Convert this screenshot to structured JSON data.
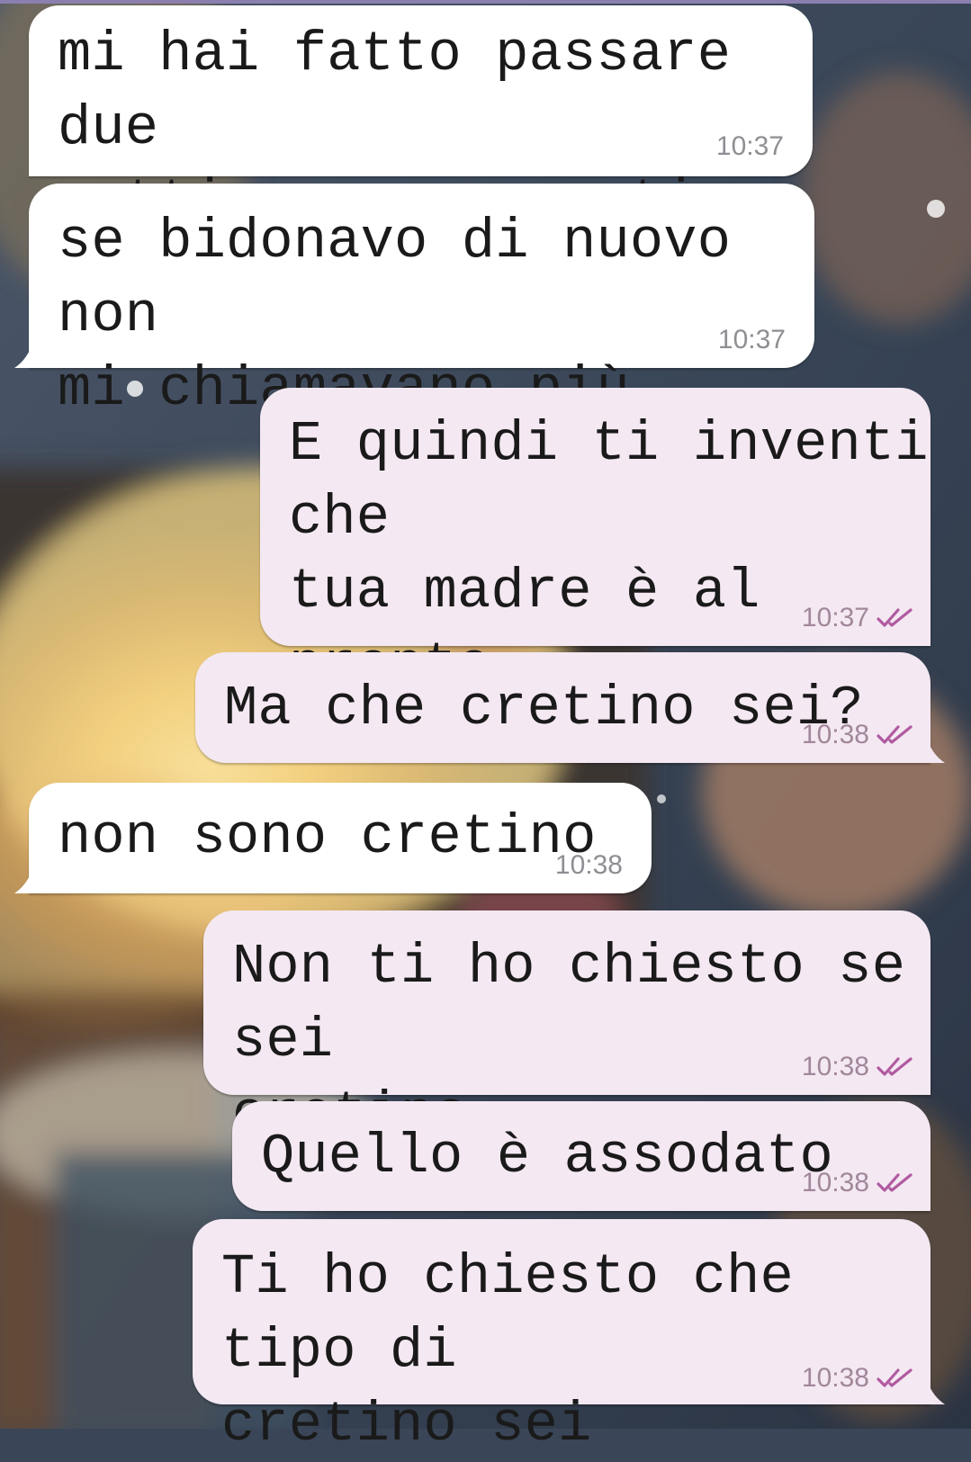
{
  "colors": {
    "incoming_bubble": "#ffffff",
    "outgoing_bubble": "#f4e8f2",
    "read_check": "#b05aa0",
    "timestamp": "#8e8e93"
  },
  "messages": [
    {
      "id": "m1",
      "direction": "incoming",
      "text": "mi hai fatto passare due\nsettimane consecutive",
      "time": "10:37"
    },
    {
      "id": "m2",
      "direction": "incoming",
      "text": "se bidonavo di nuovo non\nmi chiamavano più",
      "time": "10:37"
    },
    {
      "id": "m3",
      "direction": "outgoing",
      "text": "E quindi ti inventi che\ntua madre è al pronto\nsoccorso??",
      "time": "10:37",
      "status_icon": "double-check-read-icon"
    },
    {
      "id": "m4",
      "direction": "outgoing",
      "text": "Ma che cretino sei?",
      "time": "10:38",
      "status_icon": "double-check-read-icon"
    },
    {
      "id": "m5",
      "direction": "incoming",
      "text": "non sono cretino",
      "time": "10:38"
    },
    {
      "id": "m6",
      "direction": "outgoing",
      "text": "Non ti ho chiesto se sei\ncretino",
      "time": "10:38",
      "status_icon": "double-check-read-icon"
    },
    {
      "id": "m7",
      "direction": "outgoing",
      "text": "Quello è assodato",
      "time": "10:38",
      "status_icon": "double-check-read-icon"
    },
    {
      "id": "m8",
      "direction": "outgoing",
      "text": "Ti ho chiesto che tipo di\ncretino sei",
      "time": "10:38",
      "status_icon": "double-check-read-icon"
    }
  ]
}
